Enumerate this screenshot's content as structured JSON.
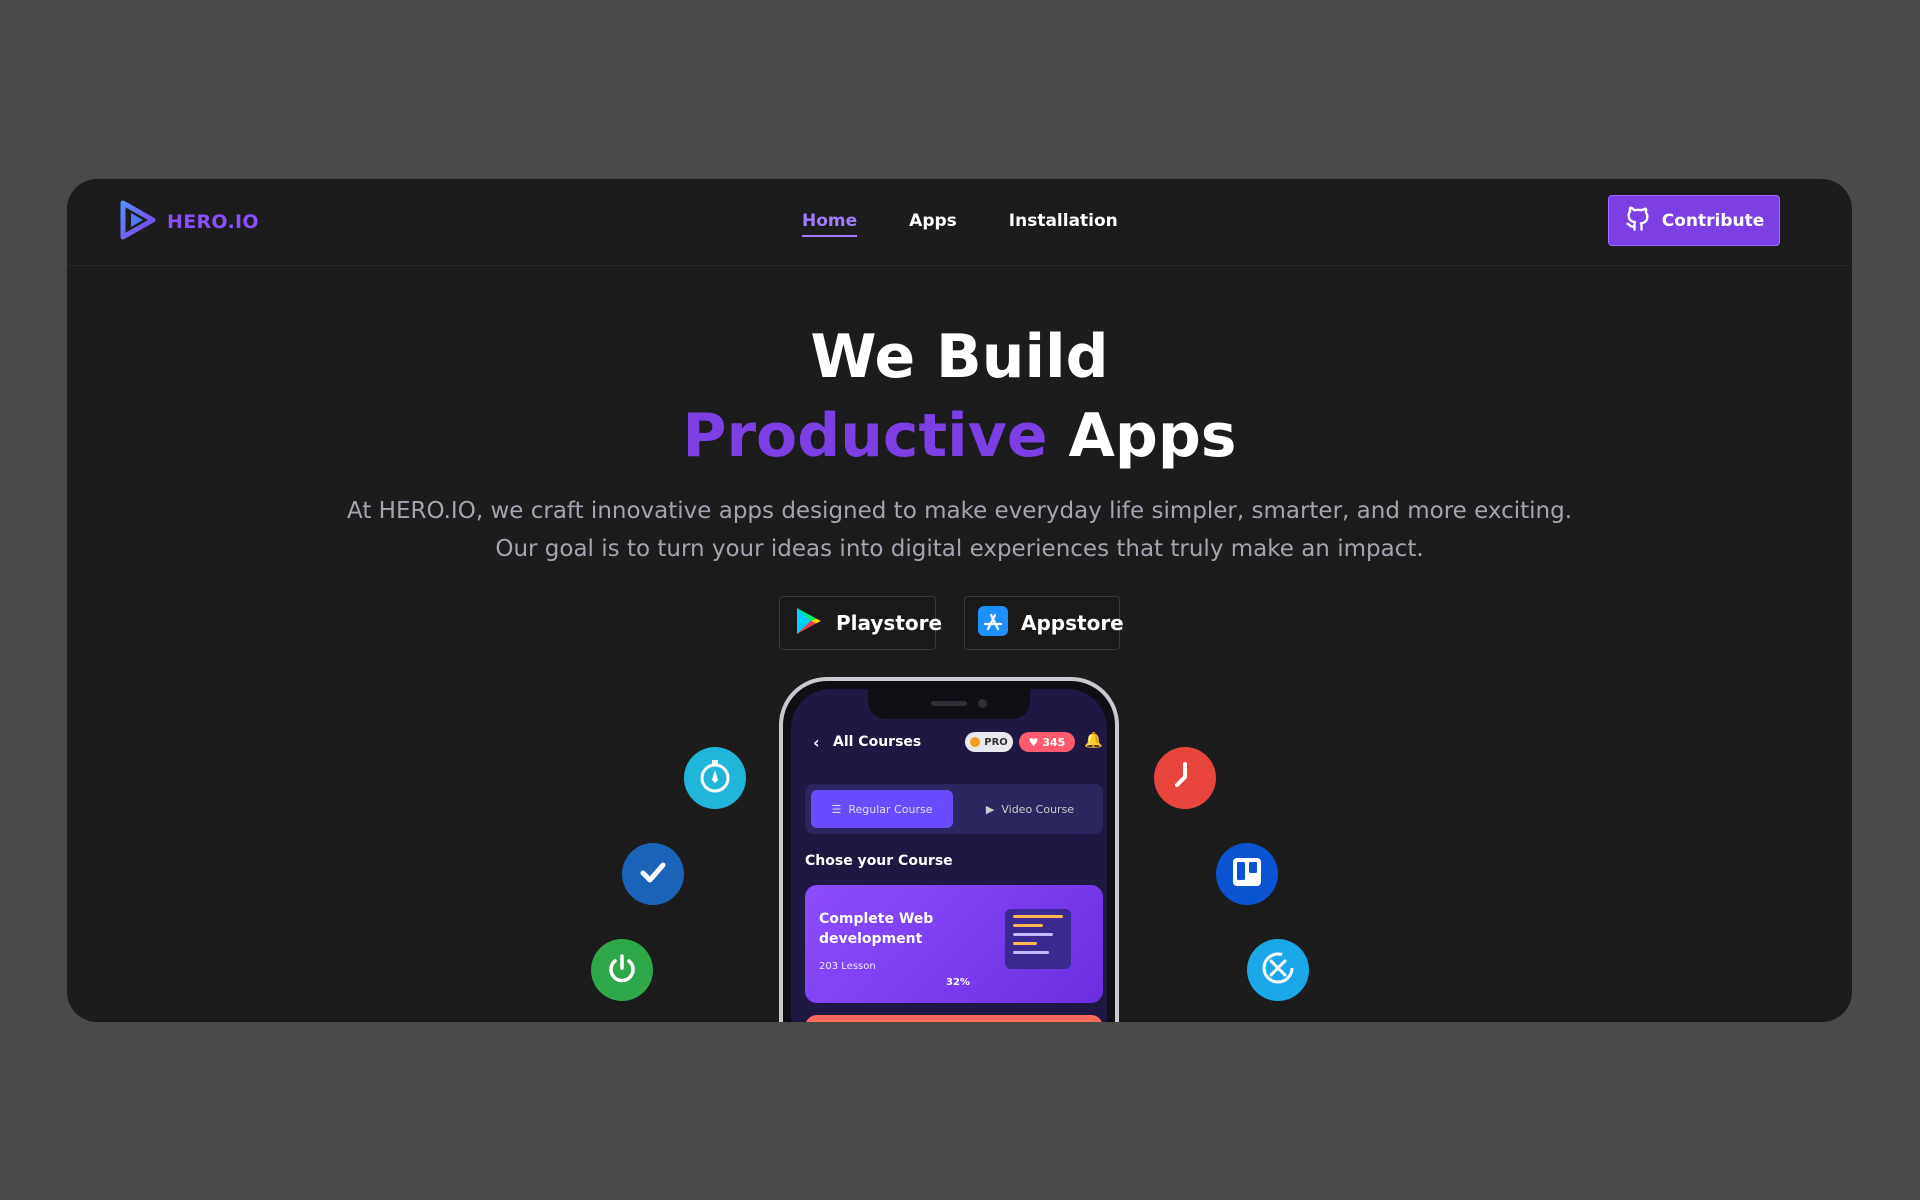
{
  "brand": {
    "name": "HERO.IO",
    "logo_icon": "play-triangle-logo-icon",
    "color": "#8a4fff"
  },
  "nav": {
    "items": [
      {
        "label": "Home",
        "active": true
      },
      {
        "label": "Apps",
        "active": false
      },
      {
        "label": "Installation",
        "active": false
      }
    ],
    "contribute_label": "Contribute",
    "contribute_icon": "github-icon"
  },
  "hero": {
    "title_line1": "We Build",
    "title_highlight": "Productive",
    "title_rest": "Apps",
    "subtitle_line1": "At HERO.IO, we craft innovative apps designed to make everyday life simpler, smarter, and more exciting.",
    "subtitle_line2": "Our goal is to turn your ideas into digital experiences that truly make an impact.",
    "accent_color": "#7b3fe4"
  },
  "stores": {
    "playstore_label": "Playstore",
    "appstore_label": "Appstore"
  },
  "floating_icons": [
    "stopwatch-icon",
    "check-icon",
    "power-icon",
    "clock-icon",
    "trello-icon",
    "timer-icon"
  ],
  "phone": {
    "header_title": "All Courses",
    "pro_badge": "PRO",
    "hearts_count": "345",
    "tab_regular": "Regular Course",
    "tab_video": "Video Course",
    "choose_heading": "Chose your Course",
    "card_title_line1": "Complete Web",
    "card_title_line2": "development",
    "card_lessons": "203 Lesson",
    "card_progress": "32%"
  }
}
